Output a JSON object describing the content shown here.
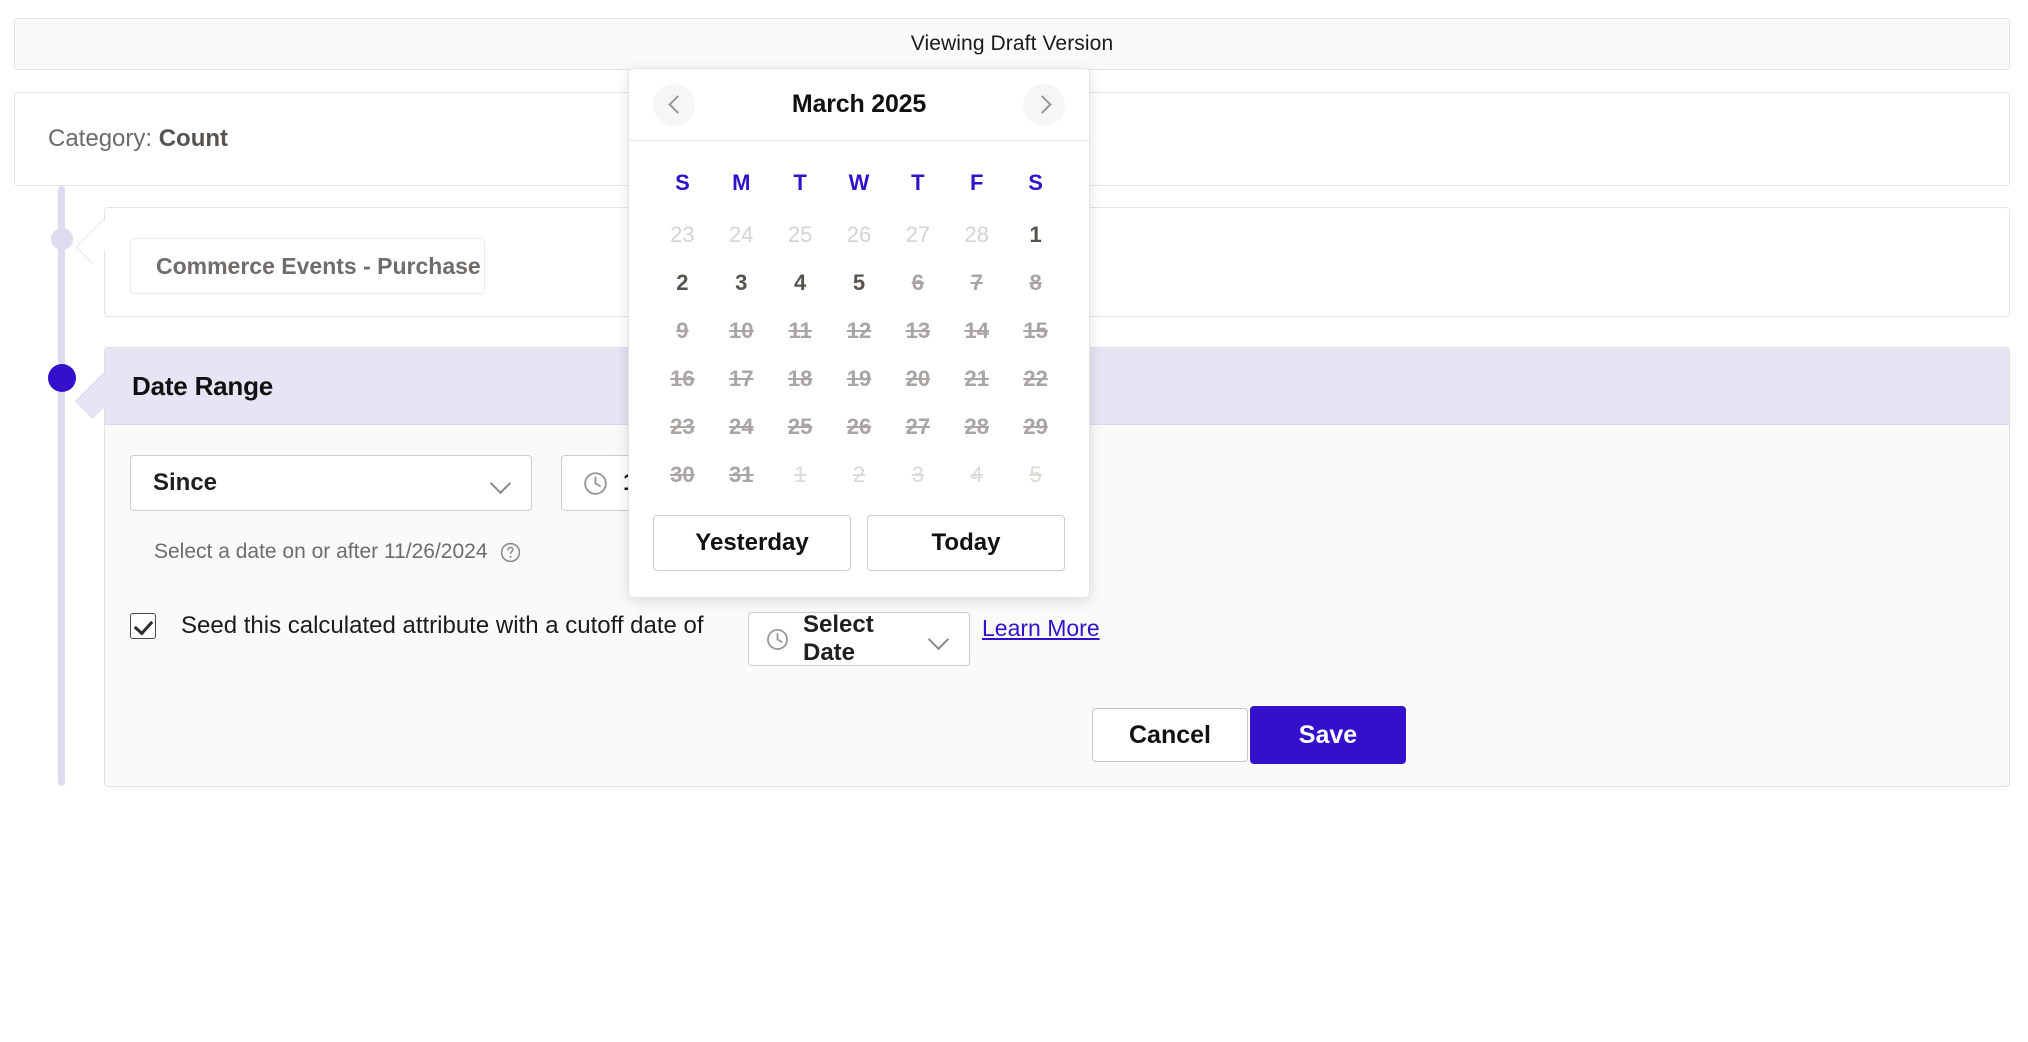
{
  "topbar": {
    "title": "Viewing Draft Version"
  },
  "category": {
    "prefix": "Category: ",
    "value": "Count"
  },
  "event": {
    "pill_label": "Commerce Events - Purchase"
  },
  "date_range": {
    "section_title": "Date Range",
    "operator_value": "Since",
    "time_value": "11",
    "helper_text": "Select a date on or after 11/26/2024",
    "help_icon": "question-circle-icon",
    "clock_icon": "clock-icon",
    "chevron_icon": "chevron-down-icon"
  },
  "seed": {
    "checked": true,
    "label": "Seed this calculated attribute with a cutoff date of",
    "date_value": "Select Date",
    "learn_more": "Learn More"
  },
  "footer": {
    "cancel_label": "Cancel",
    "save_label": "Save"
  },
  "calendar": {
    "title": "March 2025",
    "prev_icon": "chevron-left-icon",
    "next_icon": "chevron-right-icon",
    "weekdays": [
      "S",
      "M",
      "T",
      "W",
      "T",
      "F",
      "S"
    ],
    "weeks": [
      [
        {
          "d": "23",
          "state": "out"
        },
        {
          "d": "24",
          "state": "out"
        },
        {
          "d": "25",
          "state": "out"
        },
        {
          "d": "26",
          "state": "out"
        },
        {
          "d": "27",
          "state": "out"
        },
        {
          "d": "28",
          "state": "out"
        },
        {
          "d": "1",
          "state": "cur"
        }
      ],
      [
        {
          "d": "2",
          "state": "cur"
        },
        {
          "d": "3",
          "state": "cur"
        },
        {
          "d": "4",
          "state": "cur"
        },
        {
          "d": "5",
          "state": "cur"
        },
        {
          "d": "6",
          "state": "strike"
        },
        {
          "d": "7",
          "state": "strike"
        },
        {
          "d": "8",
          "state": "strike"
        }
      ],
      [
        {
          "d": "9",
          "state": "strike"
        },
        {
          "d": "10",
          "state": "strike"
        },
        {
          "d": "11",
          "state": "strike"
        },
        {
          "d": "12",
          "state": "strike"
        },
        {
          "d": "13",
          "state": "strike"
        },
        {
          "d": "14",
          "state": "strike"
        },
        {
          "d": "15",
          "state": "strike"
        }
      ],
      [
        {
          "d": "16",
          "state": "strike"
        },
        {
          "d": "17",
          "state": "strike"
        },
        {
          "d": "18",
          "state": "strike"
        },
        {
          "d": "19",
          "state": "strike"
        },
        {
          "d": "20",
          "state": "strike"
        },
        {
          "d": "21",
          "state": "strike"
        },
        {
          "d": "22",
          "state": "strike"
        }
      ],
      [
        {
          "d": "23",
          "state": "strike"
        },
        {
          "d": "24",
          "state": "strike"
        },
        {
          "d": "25",
          "state": "strike"
        },
        {
          "d": "26",
          "state": "strike"
        },
        {
          "d": "27",
          "state": "strike"
        },
        {
          "d": "28",
          "state": "strike"
        },
        {
          "d": "29",
          "state": "strike"
        }
      ],
      [
        {
          "d": "30",
          "state": "strike"
        },
        {
          "d": "31",
          "state": "strike"
        },
        {
          "d": "1",
          "state": "out strike"
        },
        {
          "d": "2",
          "state": "out strike"
        },
        {
          "d": "3",
          "state": "out strike"
        },
        {
          "d": "4",
          "state": "out strike"
        },
        {
          "d": "5",
          "state": "out strike"
        }
      ]
    ],
    "yesterday_label": "Yesterday",
    "today_label": "Today"
  },
  "colors": {
    "accent": "#3311CC",
    "section_header_bg": "#E7E5F5",
    "rail": "#DEDBF0",
    "panel_bg": "#FAFAF9",
    "muted_text": "#6f6c6a",
    "disabled_date": "#D6D3D1",
    "struck_date": "#A8A5A2"
  }
}
